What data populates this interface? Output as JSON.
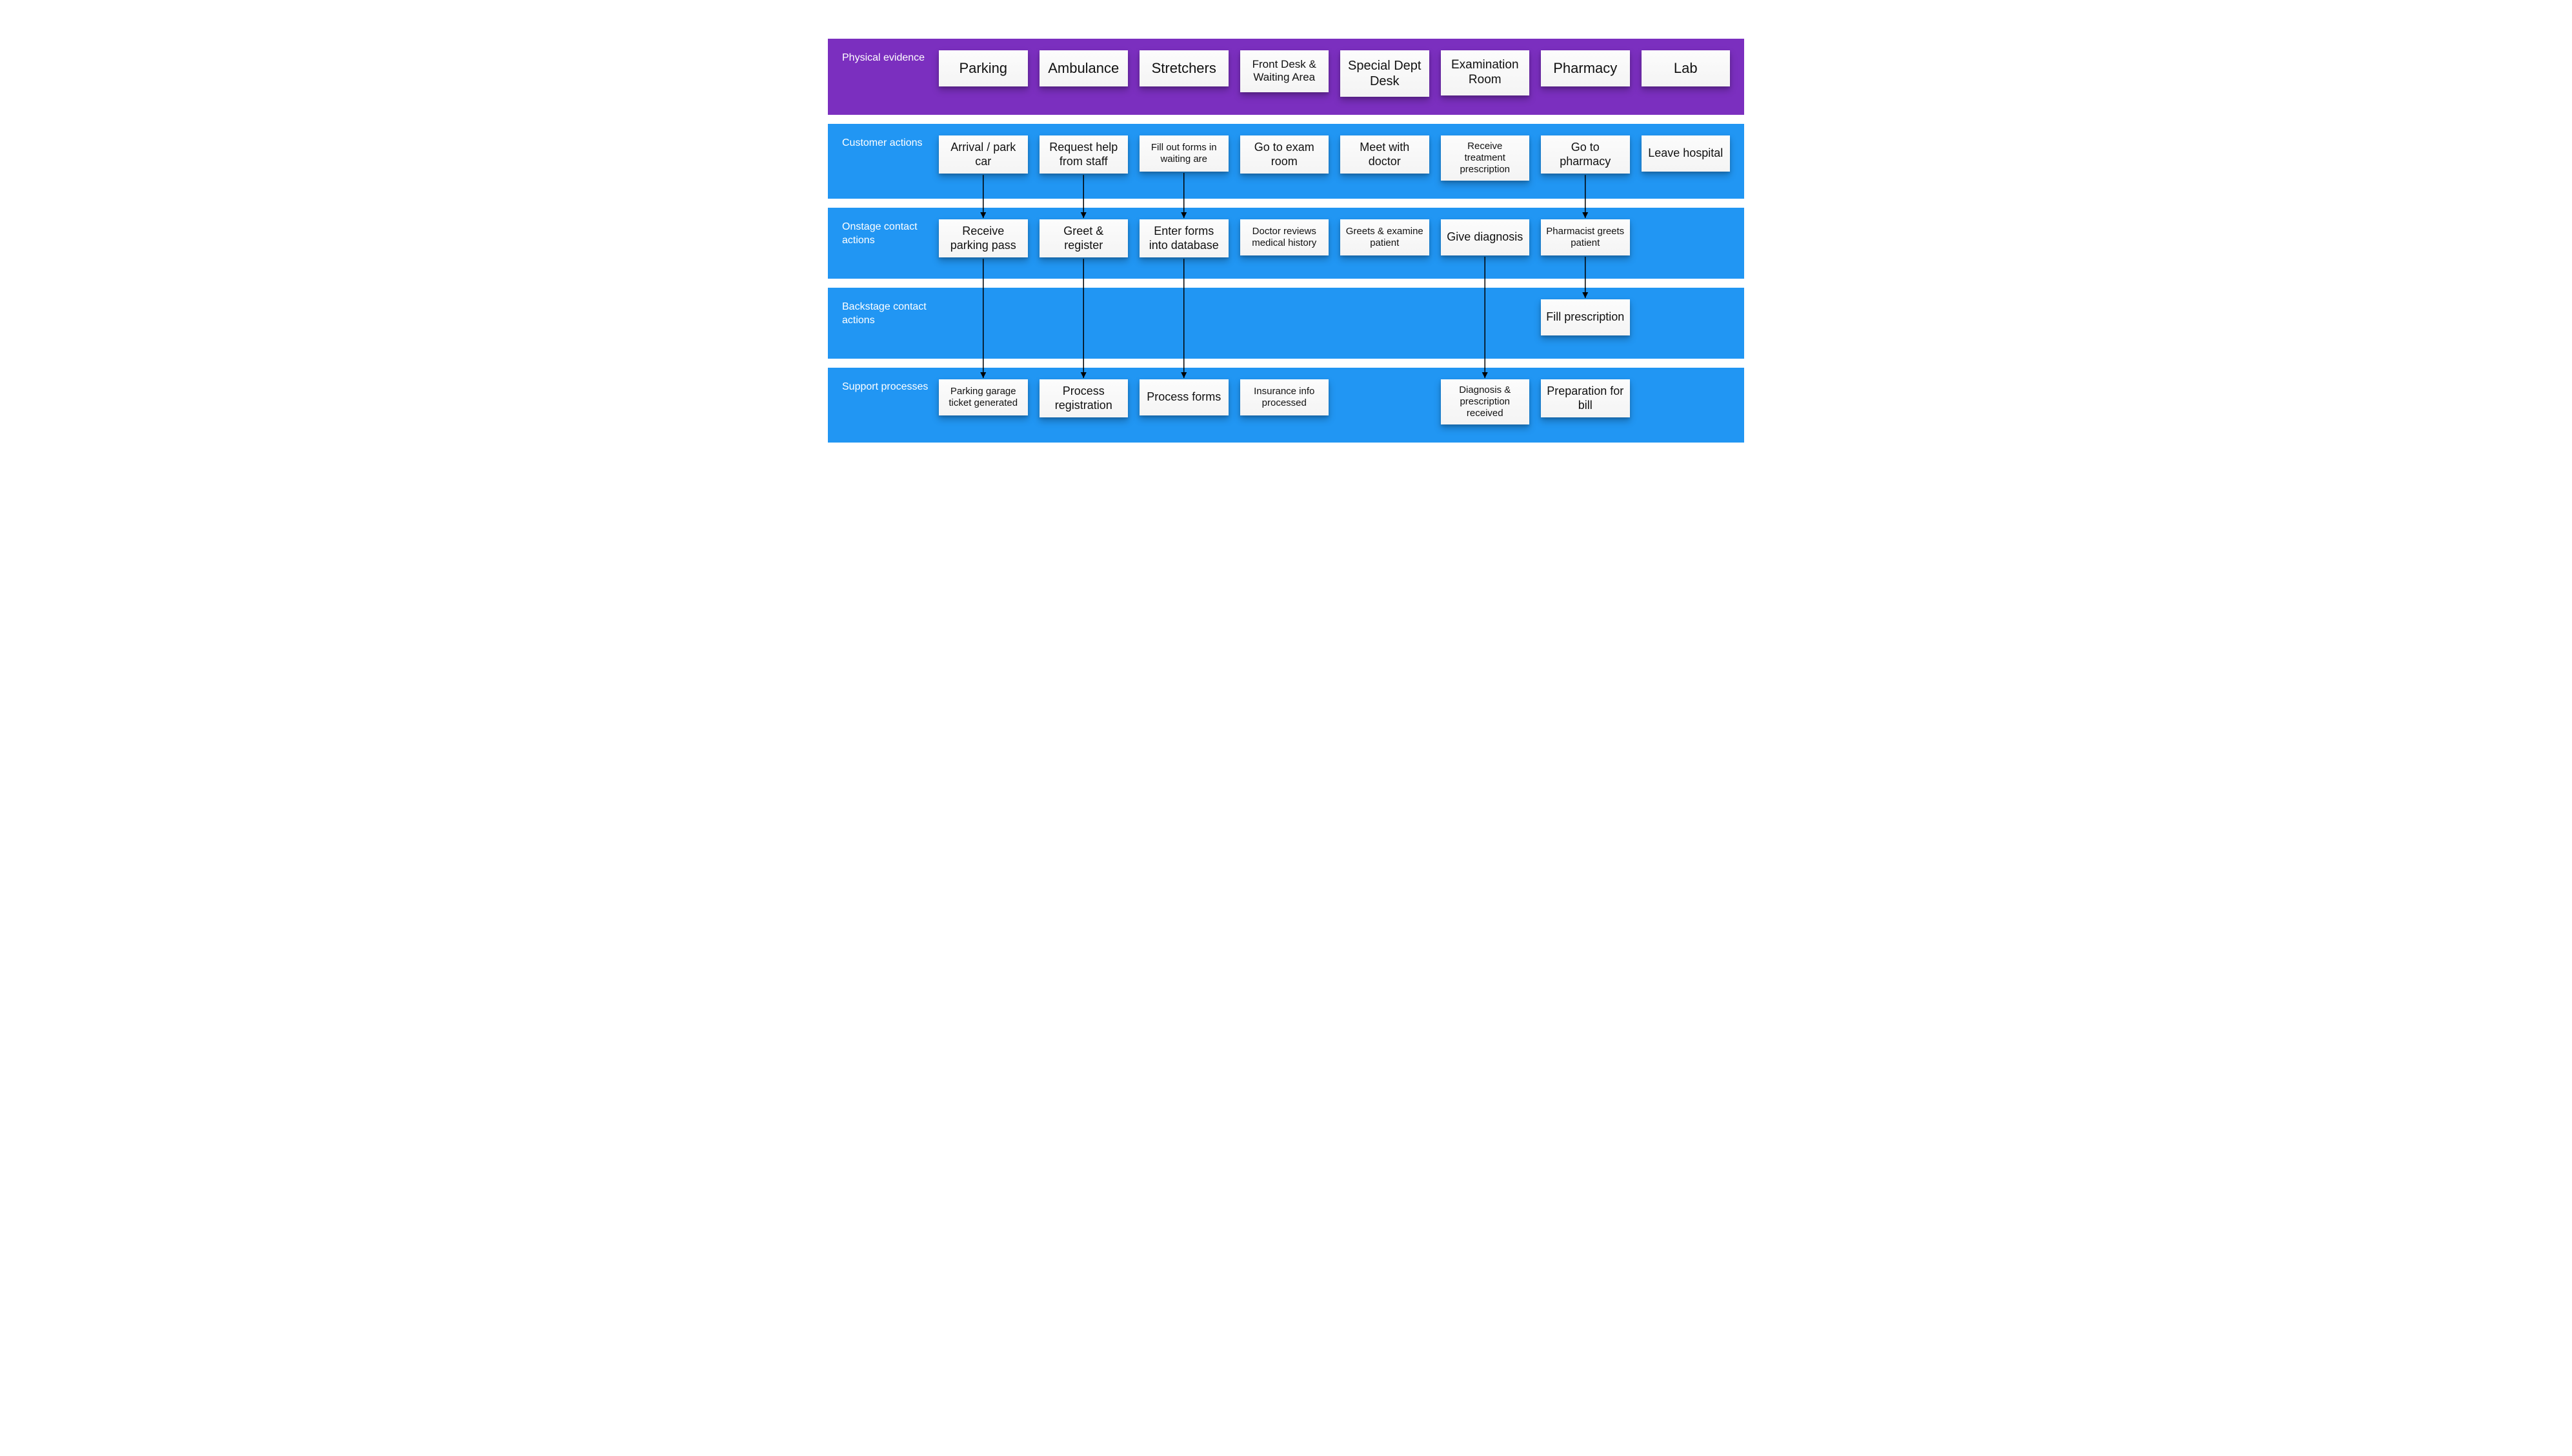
{
  "lanes": [
    {
      "id": "physical",
      "label": "Physical evidence",
      "color": "purple",
      "cards": [
        "Parking",
        "Ambulance",
        "Stretchers",
        "Front Desk & Waiting Area",
        "Special Dept Desk",
        "Examination Room",
        "Pharmacy",
        "Lab"
      ],
      "size": "big"
    },
    {
      "id": "customer",
      "label": "Customer actions",
      "color": "blue",
      "cards": [
        "Arrival / park car",
        "Request help from staff",
        "Fill out forms in waiting are",
        "Go to exam room",
        "Meet with doctor",
        "Receive treatment prescription",
        "Go to pharmacy",
        "Leave hospital"
      ]
    },
    {
      "id": "onstage",
      "label": "Onstage contact actions",
      "color": "blue",
      "cards": [
        "Receive parking pass",
        "Greet & register",
        "Enter forms into database",
        "Doctor reviews medical history",
        "Greets & examine patient",
        "Give diagnosis",
        "Pharmacist greets patient",
        ""
      ]
    },
    {
      "id": "backstage",
      "label": "Backstage contact actions",
      "color": "blue",
      "cards": [
        "",
        "",
        "",
        "",
        "",
        "",
        "Fill prescription",
        ""
      ]
    },
    {
      "id": "support",
      "label": "Support processes",
      "color": "blue",
      "cards": [
        "Parking garage ticket generated",
        "Process registration",
        "Process forms",
        "Insurance info processed",
        "",
        "Diagnosis & prescription received",
        "Preparation for bill",
        ""
      ],
      "size": "sm"
    }
  ],
  "arrows": [
    {
      "from": "customer.0",
      "to": "onstage.0"
    },
    {
      "from": "customer.1",
      "to": "onstage.1"
    },
    {
      "from": "customer.2",
      "to": "onstage.2"
    },
    {
      "from": "customer.6",
      "to": "onstage.6"
    },
    {
      "from": "onstage.0",
      "to": "support.0"
    },
    {
      "from": "onstage.1",
      "to": "support.1"
    },
    {
      "from": "onstage.2",
      "to": "support.2"
    },
    {
      "from": "onstage.5",
      "to": "support.5"
    },
    {
      "from": "onstage.6",
      "to": "backstage.6"
    }
  ]
}
